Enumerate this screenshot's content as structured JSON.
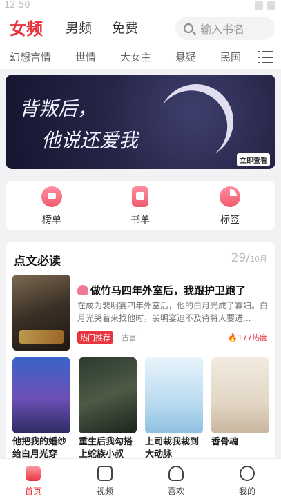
{
  "status_bar": {
    "time": "12:50"
  },
  "header": {
    "tabs": [
      {
        "label": "女频",
        "active": true
      },
      {
        "label": "男频",
        "active": false
      },
      {
        "label": "免费",
        "active": false
      }
    ],
    "search_placeholder": "输入书名"
  },
  "categories": [
    "幻想言情",
    "世情",
    "大女主",
    "悬疑",
    "民国"
  ],
  "banner": {
    "title_line1": "背叛后，",
    "title_line2": "他说还爱我",
    "button": "立即查看"
  },
  "quick_links": [
    {
      "label": "榜单",
      "icon": "crown-icon"
    },
    {
      "label": "书单",
      "icon": "booklist-icon"
    },
    {
      "label": "标签",
      "icon": "tag-icon"
    }
  ],
  "section": {
    "title": "点文必读",
    "date_day": "29/",
    "date_month": "10月",
    "featured": {
      "title": "做竹马四年外室后，我跟护卫跑了",
      "description": "在成为裴明宴四年外室后，他的白月光成了寡妇。白月光哭着来找他时，裴明宴迫不及待将人要进...",
      "badge": "热门推荐",
      "genre": "古言",
      "heat": "177热度"
    },
    "books": [
      {
        "title": "他把我的婚纱给白月光穿"
      },
      {
        "title": "重生后我勾搭上蛇族小叔"
      },
      {
        "title": "上司栽我栽到大动脉"
      },
      {
        "title": "香骨魂"
      }
    ]
  },
  "bottom_nav": [
    {
      "label": "首页",
      "active": true
    },
    {
      "label": "视频",
      "active": false
    },
    {
      "label": "喜欢",
      "active": false
    },
    {
      "label": "我的",
      "active": false
    }
  ],
  "colors": {
    "accent": "#e8343e",
    "background": "#f2f2f4"
  }
}
